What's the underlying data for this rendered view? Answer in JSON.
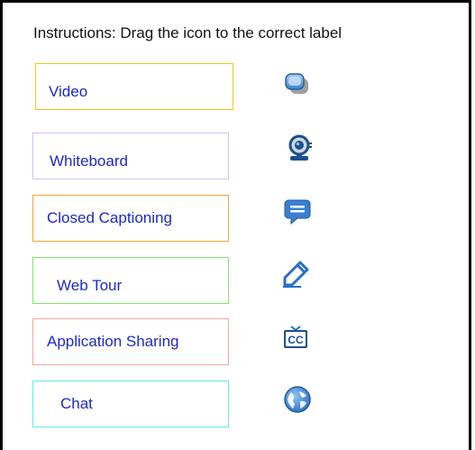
{
  "instructions": "Instructions: Drag the icon to the correct label",
  "labels": [
    {
      "text": "Video",
      "border_color": "#f5c518"
    },
    {
      "text": "Whiteboard",
      "border_color": "#c9c7f5"
    },
    {
      "text": "Closed Captioning",
      "border_color": "#f5a13d"
    },
    {
      "text": "Web Tour",
      "border_color": "#7de46a"
    },
    {
      "text": "Application Sharing",
      "border_color": "#f5a3a3"
    },
    {
      "text": "Chat",
      "border_color": "#64e8f0"
    }
  ],
  "icons": [
    {
      "name": "chat-bubbles-icon"
    },
    {
      "name": "webcam-icon"
    },
    {
      "name": "speech-bubble-icon"
    },
    {
      "name": "pencil-icon"
    },
    {
      "name": "closed-caption-icon"
    },
    {
      "name": "globe-icon"
    }
  ],
  "colors": {
    "label_text": "#1c29c9",
    "icon_blue": "#3a7fd0"
  }
}
